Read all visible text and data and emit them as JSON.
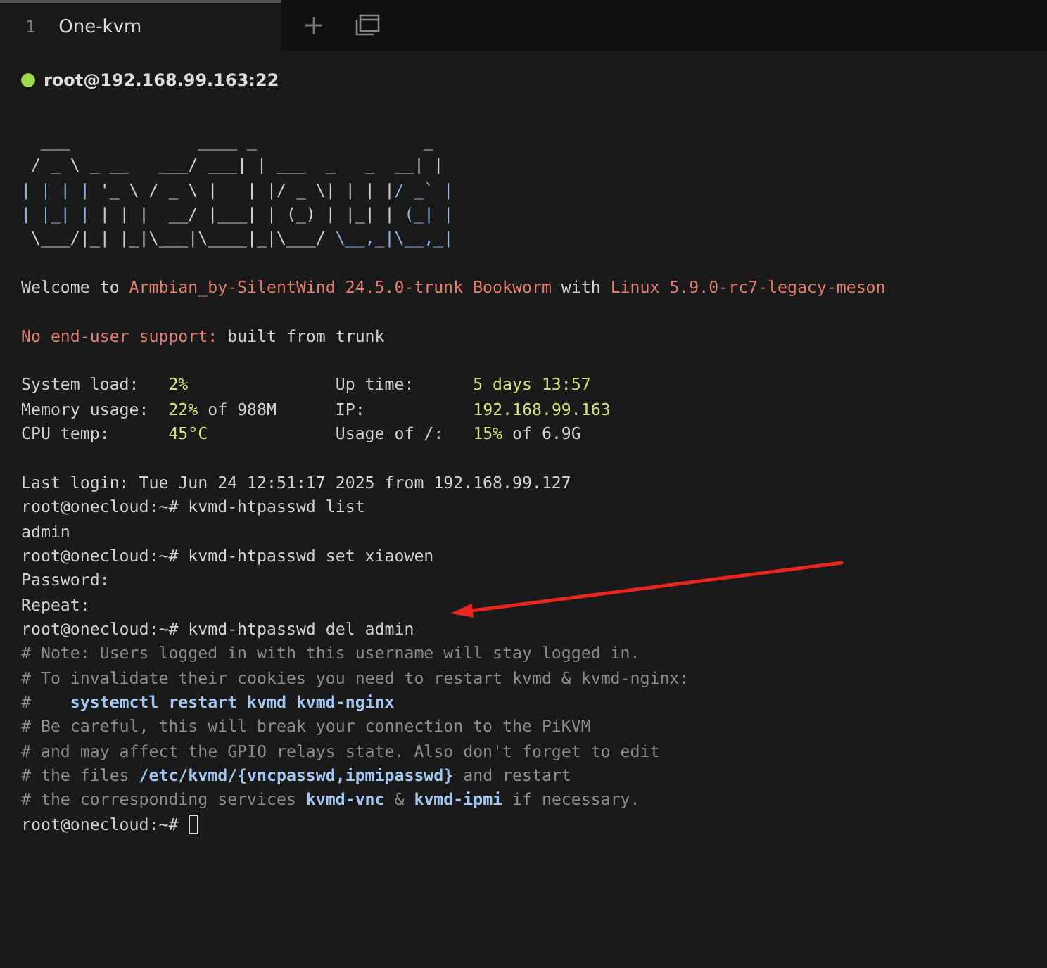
{
  "tabs": [
    {
      "number": "1",
      "label": "One-kvm",
      "selected": true
    }
  ],
  "connection": {
    "connected": true,
    "label": "root@192.168.99.163:22"
  },
  "terminal": {
    "cursor_visible": true,
    "lines": [
      {
        "kind": "art",
        "segments": [
          {
            "kind": "art",
            "text": "  ___             ____ _                 _ "
          }
        ]
      },
      {
        "kind": "art",
        "segments": [
          {
            "kind": "art",
            "text": " / _ \\ _ __   ___/ ___| | ___  _   _  __| |"
          }
        ]
      },
      {
        "kind": "art",
        "segments": [
          {
            "kind": "art-accent",
            "text": "| | | |"
          },
          {
            "kind": "art",
            "text": " '_ \\ / _ \\ |   | |/ _ \\| | | |"
          },
          {
            "kind": "art-accent",
            "text": "/ _` |"
          }
        ]
      },
      {
        "kind": "art",
        "segments": [
          {
            "kind": "art-accent",
            "text": "| |_| |"
          },
          {
            "kind": "art",
            "text": " | | |  __/ |___| | (_) | |_| |"
          },
          {
            "kind": "art-accent",
            "text": " (_| |"
          }
        ]
      },
      {
        "kind": "art",
        "segments": [
          {
            "kind": "art",
            "text": " \\___/|_| |_|\\___|\\____|_|\\___/ "
          },
          {
            "kind": "art-accent",
            "text": "\\__,_|\\__,_|"
          }
        ]
      },
      {
        "kind": "blank"
      },
      {
        "kind": "text",
        "segments": [
          {
            "kind": "plain",
            "text": "Welcome to "
          },
          {
            "kind": "warm",
            "text": "Armbian_by-SilentWind 24.5.0-trunk Bookworm"
          },
          {
            "kind": "plain",
            "text": " with "
          },
          {
            "kind": "warm",
            "text": "Linux 5.9.0-rc7-legacy-meson"
          }
        ]
      },
      {
        "kind": "blank"
      },
      {
        "kind": "text",
        "segments": [
          {
            "kind": "warm",
            "text": "No end-user support:"
          },
          {
            "kind": "plain",
            "text": " built from trunk"
          }
        ]
      },
      {
        "kind": "blank"
      },
      {
        "kind": "text",
        "segments": [
          {
            "kind": "plain",
            "text": "System load:   "
          },
          {
            "kind": "value",
            "text": "2%"
          },
          {
            "kind": "plain",
            "text": "               Up time:      "
          },
          {
            "kind": "value",
            "text": "5 days 13:57"
          }
        ]
      },
      {
        "kind": "text",
        "segments": [
          {
            "kind": "plain",
            "text": "Memory usage:  "
          },
          {
            "kind": "value",
            "text": "22%"
          },
          {
            "kind": "plain",
            "text": " of 988M      IP:           "
          },
          {
            "kind": "value",
            "text": "192.168.99.163"
          }
        ]
      },
      {
        "kind": "text",
        "segments": [
          {
            "kind": "plain",
            "text": "CPU temp:      "
          },
          {
            "kind": "value",
            "text": "45°C"
          },
          {
            "kind": "plain",
            "text": "             Usage of /:   "
          },
          {
            "kind": "value",
            "text": "15%"
          },
          {
            "kind": "plain",
            "text": " of 6.9G"
          }
        ]
      },
      {
        "kind": "blank"
      },
      {
        "kind": "text",
        "segments": [
          {
            "kind": "plain",
            "text": "Last login: Tue Jun 24 12:51:17 2025 from 192.168.99.127"
          }
        ]
      },
      {
        "kind": "text",
        "segments": [
          {
            "kind": "plain",
            "text": "root@onecloud:~# kvmd-htpasswd list"
          }
        ]
      },
      {
        "kind": "text",
        "segments": [
          {
            "kind": "plain",
            "text": "admin"
          }
        ]
      },
      {
        "kind": "text",
        "segments": [
          {
            "kind": "plain",
            "text": "root@onecloud:~# kvmd-htpasswd set xiaowen"
          }
        ]
      },
      {
        "kind": "text",
        "segments": [
          {
            "kind": "plain",
            "text": "Password:"
          }
        ]
      },
      {
        "kind": "text",
        "segments": [
          {
            "kind": "plain",
            "text": "Repeat:"
          }
        ]
      },
      {
        "kind": "text",
        "segments": [
          {
            "kind": "plain",
            "text": "root@onecloud:~# kvmd-htpasswd del admin"
          }
        ]
      },
      {
        "kind": "text",
        "segments": [
          {
            "kind": "comment",
            "text": "# Note: Users logged in with this username will stay logged in."
          }
        ]
      },
      {
        "kind": "text",
        "segments": [
          {
            "kind": "comment",
            "text": "# To invalidate their cookies you need to restart kvmd & kvmd-nginx:"
          }
        ]
      },
      {
        "kind": "text",
        "segments": [
          {
            "kind": "comment",
            "text": "#    "
          },
          {
            "kind": "keyword",
            "text": "systemctl restart kvmd kvmd-nginx"
          }
        ]
      },
      {
        "kind": "text",
        "segments": [
          {
            "kind": "comment",
            "text": "# Be careful, this will break your connection to the PiKVM"
          }
        ]
      },
      {
        "kind": "text",
        "segments": [
          {
            "kind": "comment",
            "text": "# and may affect the GPIO relays state. Also don't forget to edit"
          }
        ]
      },
      {
        "kind": "text",
        "segments": [
          {
            "kind": "comment",
            "text": "# the files "
          },
          {
            "kind": "keyword",
            "text": "/etc/kvmd/{vncpasswd,ipmipasswd}"
          },
          {
            "kind": "comment",
            "text": " and restart"
          }
        ]
      },
      {
        "kind": "text",
        "segments": [
          {
            "kind": "comment",
            "text": "# the corresponding services "
          },
          {
            "kind": "keyword",
            "text": "kvmd-vnc"
          },
          {
            "kind": "comment",
            "text": " & "
          },
          {
            "kind": "keyword",
            "text": "kvmd-ipmi"
          },
          {
            "kind": "comment",
            "text": " if necessary."
          }
        ]
      },
      {
        "kind": "text",
        "segments": [
          {
            "kind": "plain",
            "text": "root@onecloud:~# "
          }
        ]
      }
    ]
  }
}
